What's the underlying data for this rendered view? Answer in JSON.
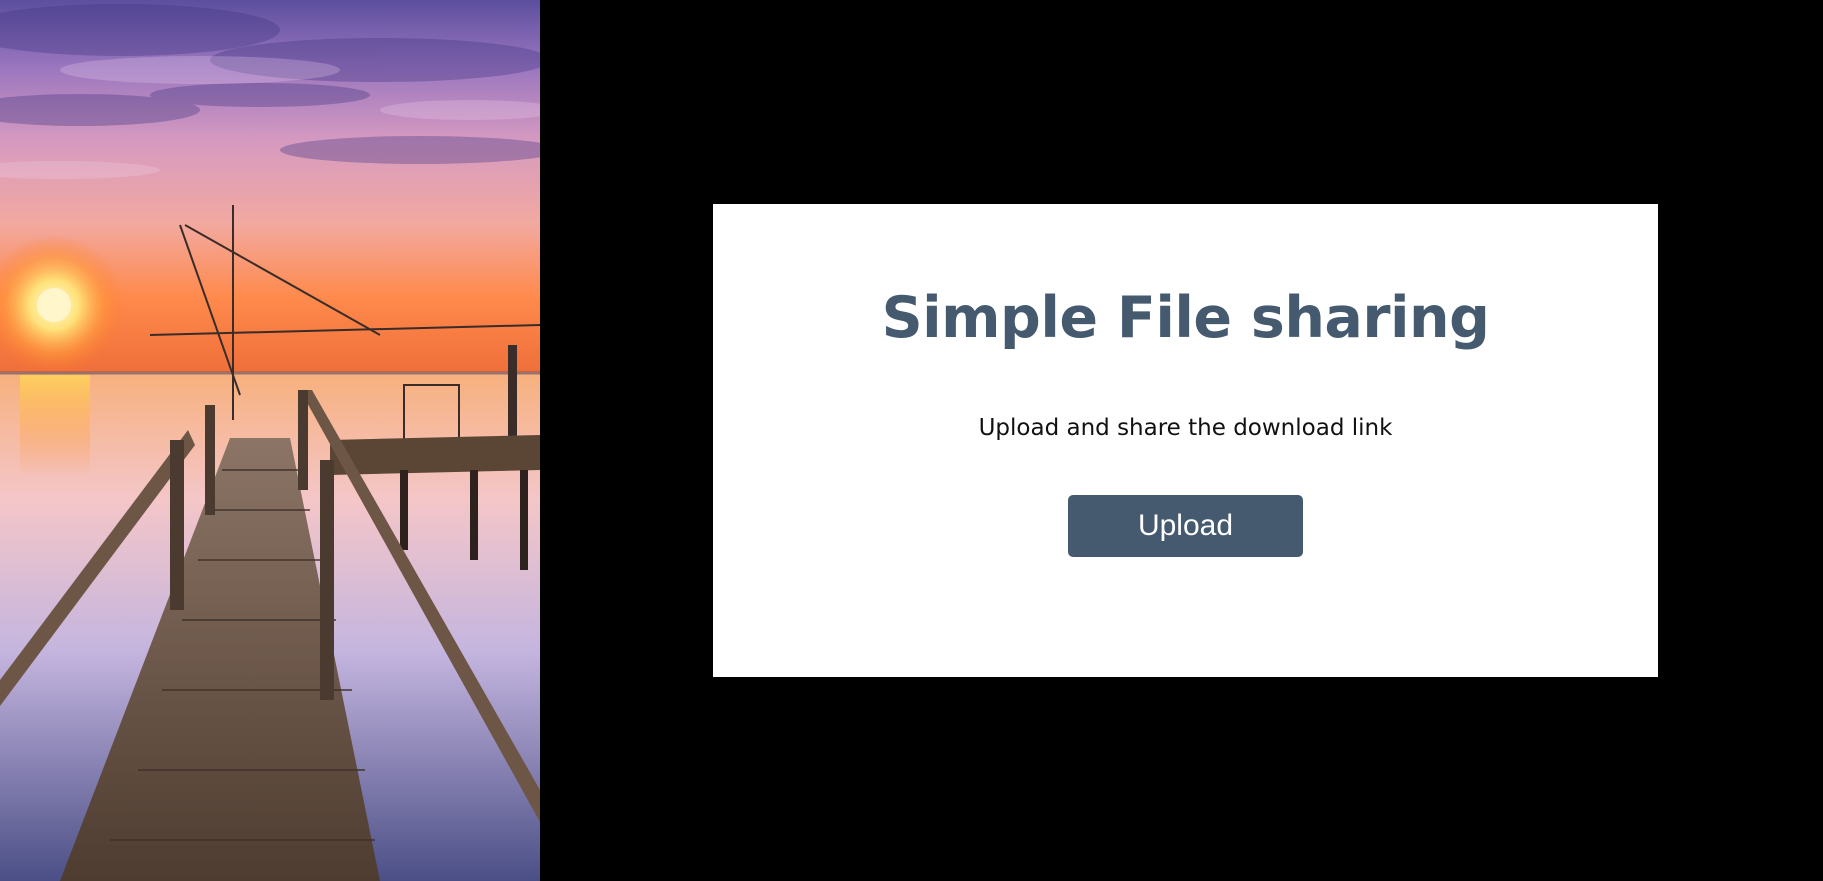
{
  "hero": {
    "image_icon": "pier-sunset-photo",
    "colors": {
      "sky_top": "#6b5aa8",
      "sky_mid": "#c88ab8",
      "horizon": "#ff7a2a",
      "sun": "#fff1b0",
      "water": "#a9b6df",
      "wood": "#6a5444"
    }
  },
  "card": {
    "title": "Simple File sharing",
    "subtitle": "Upload and share the download link",
    "upload_label": "Upload"
  },
  "colors": {
    "page_background": "#000000",
    "card_background": "#ffffff",
    "accent": "#455a6f",
    "button_text": "#ffffff",
    "subtitle_text": "#111111"
  }
}
